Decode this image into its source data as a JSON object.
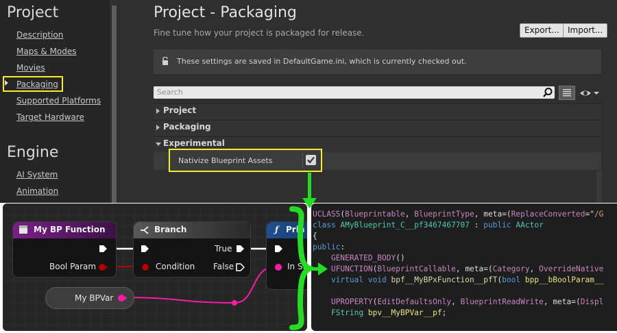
{
  "sidebar": {
    "project_heading": "Project",
    "project_items": [
      "Description",
      "Maps & Modes",
      "Movies",
      "Packaging",
      "Supported Platforms",
      "Target Hardware"
    ],
    "engine_heading": "Engine",
    "engine_items": [
      "AI System",
      "Animation"
    ],
    "selected_item": "Packaging"
  },
  "header": {
    "title": "Project - Packaging",
    "subtitle": "Fine tune how your project is packaged for release.",
    "export_label": "Export...",
    "import_label": "Import..."
  },
  "notice": {
    "text": "These settings are saved in DefaultGame.ini, which is currently checked out.",
    "icon": "lock-icon"
  },
  "search": {
    "placeholder": "Search"
  },
  "categories": [
    {
      "label": "Project",
      "expanded": false
    },
    {
      "label": "Packaging",
      "expanded": false
    },
    {
      "label": "Experimental",
      "expanded": true
    }
  ],
  "setting": {
    "label": "Nativize Blueprint Assets",
    "checked": true
  },
  "graph": {
    "function_node": {
      "title": "My BP Function",
      "param": "Bool Param"
    },
    "branch_node": {
      "title": "Branch",
      "condition": "Condition",
      "true_label": "True",
      "false_label": "False"
    },
    "print_node": {
      "title": "Prin",
      "input": "In Str"
    },
    "variable_node": {
      "label": "My BPVar"
    }
  },
  "code_lines": [
    [
      [
        "m",
        "UCLASS"
      ],
      [
        "p",
        "("
      ],
      [
        "k",
        "Blueprintable"
      ],
      [
        "p",
        ", "
      ],
      [
        "k",
        "BlueprintType"
      ],
      [
        "p",
        ", meta=("
      ],
      [
        "k",
        "ReplaceConverted"
      ],
      [
        "p",
        "=\""
      ],
      [
        "s",
        "/G"
      ]
    ],
    [
      [
        "b",
        "class "
      ],
      [
        "t",
        "AMyBlueprint_C__pf3467467707"
      ],
      [
        "p",
        " : "
      ],
      [
        "b",
        "public "
      ],
      [
        "t",
        "AActor"
      ]
    ],
    [
      [
        "p",
        "{"
      ]
    ],
    [
      [
        "b",
        "public"
      ],
      [
        "p",
        ":"
      ]
    ],
    [
      [
        "p",
        "    "
      ],
      [
        "m",
        "GENERATED_BODY"
      ],
      [
        "p",
        "()"
      ]
    ],
    [
      [
        "p",
        "    "
      ],
      [
        "m",
        "UFUNCTION"
      ],
      [
        "p",
        "("
      ],
      [
        "k",
        "BlueprintCallable"
      ],
      [
        "p",
        ", meta=("
      ],
      [
        "k",
        "Category"
      ],
      [
        "p",
        ", "
      ],
      [
        "k",
        "OverrideNative"
      ]
    ],
    [
      [
        "p",
        "    "
      ],
      [
        "b",
        "virtual void "
      ],
      [
        "f",
        "bpf__MyBPxFunction__pfT"
      ],
      [
        "p",
        "("
      ],
      [
        "b",
        "bool "
      ],
      [
        "y",
        "bpp__bBoolParam__"
      ]
    ],
    [
      [
        "p",
        ""
      ]
    ],
    [
      [
        "p",
        "    "
      ],
      [
        "m",
        "UPROPERTY"
      ],
      [
        "p",
        "("
      ],
      [
        "k",
        "EditDefaultsOnly"
      ],
      [
        "p",
        ", "
      ],
      [
        "k",
        "BlueprintReadWrite"
      ],
      [
        "p",
        ", meta=("
      ],
      [
        "k",
        "Displ"
      ]
    ],
    [
      [
        "p",
        "    "
      ],
      [
        "t",
        "FString "
      ],
      [
        "y",
        "bpv__MyBPVar__pf"
      ],
      [
        "p",
        ";"
      ]
    ]
  ],
  "colors": {
    "highlight": "#f7ee2a",
    "arrow": "#22dd22",
    "function_header": "#7a1f8a",
    "exec_white": "#ffffff",
    "bool_pin": "#b00000",
    "string_pin": "#ff1aa8"
  }
}
